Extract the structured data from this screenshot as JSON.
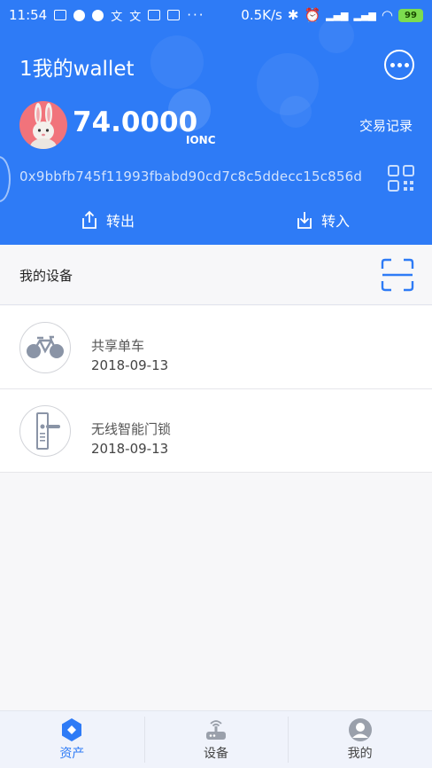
{
  "status_bar": {
    "time": "11:54",
    "network_speed": "0.5K/s",
    "battery": "99"
  },
  "wallet": {
    "title": "1我的wallet",
    "balance": "74.0000",
    "unit": "IONC",
    "tx_records_label": "交易记录",
    "address": "0x9bbfb745f11993fbabd90cd7c8c5ddecc15c856d",
    "transfer_out_label": "转出",
    "transfer_in_label": "转入"
  },
  "devices": {
    "section_title": "我的设备",
    "items": [
      {
        "name": "共享单车",
        "date": "2018-09-13",
        "icon": "bicycle-icon"
      },
      {
        "name": "无线智能门锁",
        "date": "2018-09-13",
        "icon": "door-lock-icon"
      }
    ]
  },
  "bottom_nav": {
    "items": [
      {
        "label": "资产",
        "icon": "asset-icon",
        "active": true
      },
      {
        "label": "设备",
        "icon": "router-icon",
        "active": false
      },
      {
        "label": "我的",
        "icon": "user-icon",
        "active": false
      }
    ]
  },
  "colors": {
    "primary": "#2e7bf6",
    "battery": "#7ddc4f",
    "background": "#f7f7f9"
  }
}
